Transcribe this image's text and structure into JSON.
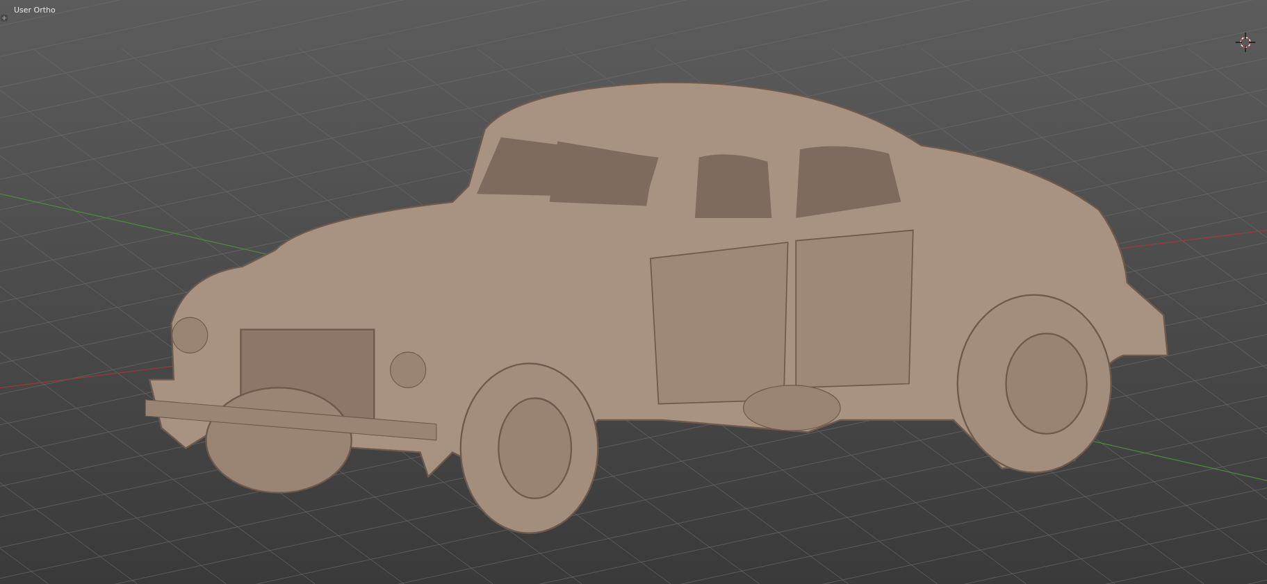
{
  "viewport": {
    "title": "User Ortho"
  }
}
